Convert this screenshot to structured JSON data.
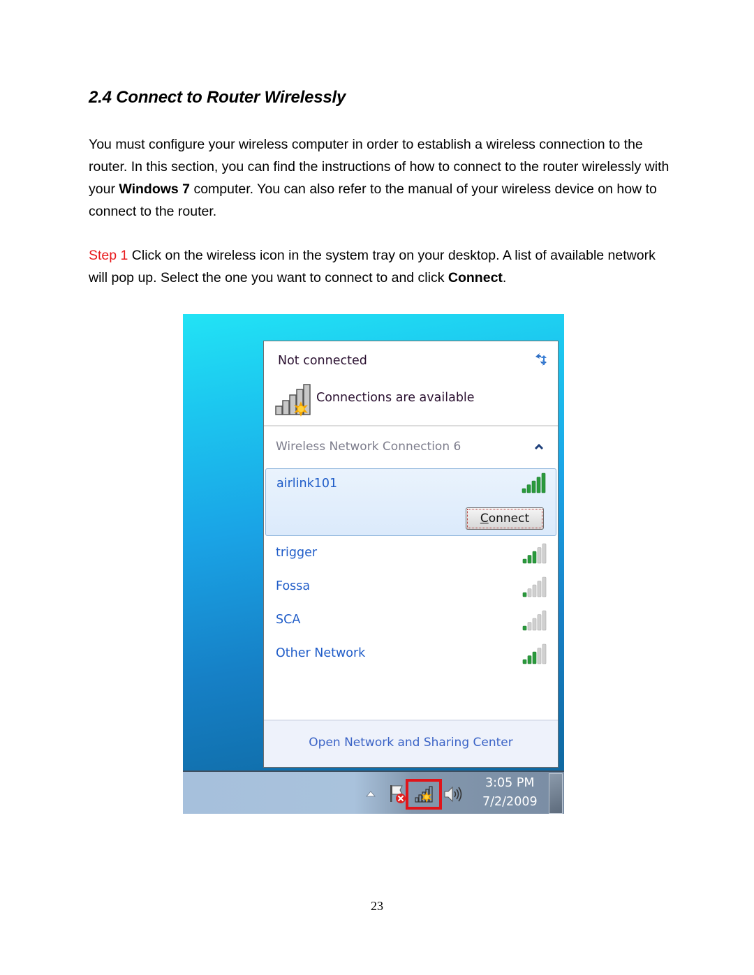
{
  "heading": "2.4 Connect to Router Wirelessly",
  "intro": {
    "part1": "You must configure your wireless computer in order to establish a wireless connection to the router. In this section, you can find the instructions of how to connect to the router wirelessly with your ",
    "bold": "Windows 7",
    "part2": " computer. You can also refer to the manual of your wireless device on how to connect to the router."
  },
  "step1": {
    "label": "Step 1",
    "text": " Click on the wireless icon in the system tray on your desktop. A list of available network will pop up. Select the one you want to connect to and click ",
    "bold": "Connect",
    "end": "."
  },
  "flyout": {
    "status": "Not connected",
    "availability": "Connections are available",
    "section_title": "Wireless Network Connection 6",
    "networks": [
      {
        "name": "airlink101",
        "signal_bars": 5,
        "selected": true
      },
      {
        "name": "trigger",
        "signal_bars": 3
      },
      {
        "name": "Fossa",
        "signal_bars": 1
      },
      {
        "name": "SCA",
        "signal_bars": 1
      },
      {
        "name": "Other Network",
        "signal_bars": 3
      }
    ],
    "connect_button": {
      "accel": "C",
      "rest": "onnect"
    },
    "footer_link": "Open Network and Sharing Center"
  },
  "taskbar": {
    "time": "3:05 PM",
    "date": "7/2/2009",
    "highlight_color": "#e0141a"
  },
  "page_number": "23"
}
